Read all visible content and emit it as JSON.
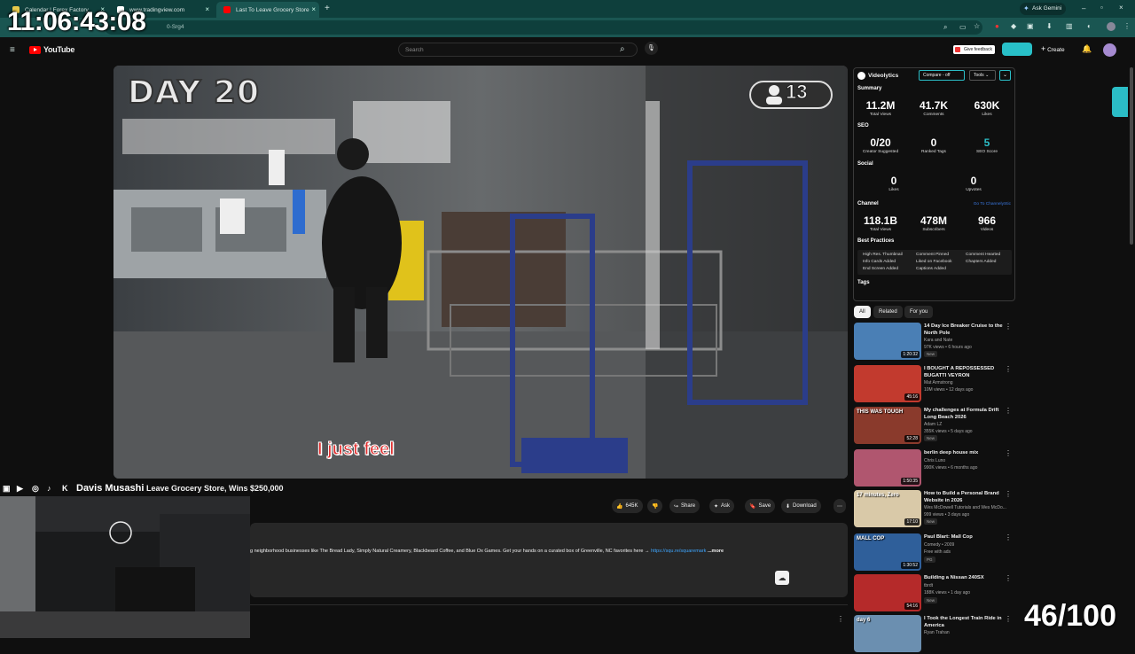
{
  "overlay": {
    "clock": "11:06:43:08",
    "counter": "46/100"
  },
  "browser": {
    "tabs": [
      {
        "title": "Calendar | Forex Factory"
      },
      {
        "title": "www.tradingview.com"
      },
      {
        "title": "Last To Leave Grocery Store"
      }
    ],
    "url": "0-Srg4",
    "gemini": "Ask Gemini"
  },
  "youtube": {
    "logo": "YouTube",
    "search_placeholder": "Search",
    "feedback": "Give feedback",
    "create": "Create"
  },
  "video": {
    "day_label": "DAY 20",
    "player_count": "13",
    "subtitle": "I just feel",
    "title": "Leave Grocery Store, Wins $250,000",
    "description": "g neighborhood businesses like The Bread Lady, Simply Natural Creamery, Blackbeard Coffee, and Blue Ox Games. Get your hands on a curated box of Greenville, NC favorites here →",
    "link": "https://squ.re/squaremark",
    "more": "...more"
  },
  "actions": {
    "likes": "645K",
    "share": "Share",
    "ask": "Ask",
    "save": "Save",
    "download": "Download"
  },
  "streamer": {
    "name": "Davis Musashi"
  },
  "videolytics": {
    "brand": "Videolytics",
    "compare": "Compare - off",
    "tools": "Tools",
    "summary_label": "Summary",
    "summary": [
      {
        "value": "11.2M",
        "label": "Total Views"
      },
      {
        "value": "41.7K",
        "label": "Comments"
      },
      {
        "value": "630K",
        "label": "Likes"
      }
    ],
    "seo_label": "SEO",
    "seo": [
      {
        "value": "0/20",
        "label": "Creator Suggested"
      },
      {
        "value": "0",
        "label": "Ranked Tags"
      },
      {
        "value": "5",
        "label": "SEO Score"
      }
    ],
    "social_label": "Social",
    "social": [
      {
        "value": "0",
        "label": "Likes"
      },
      {
        "value": "0",
        "label": "Upvotes"
      }
    ],
    "channel_label": "Channel",
    "channel_link": "Go To ChannelyStic",
    "channel": [
      {
        "value": "118.1B",
        "label": "Total Views"
      },
      {
        "value": "478M",
        "label": "Subscribers"
      },
      {
        "value": "966",
        "label": "Videos"
      }
    ],
    "best_label": "Best Practices",
    "best": [
      "High Res. Thumbnail",
      "Comment Pinned",
      "Comment Hearted",
      "Info Cards Added",
      "Liked on Facebook",
      "Chapters Added",
      "End Screen Added",
      "Captions Added"
    ],
    "tags_label": "Tags"
  },
  "chips": [
    "All",
    "Related",
    "For you"
  ],
  "recommendations": [
    {
      "title": "14 Day Ice Breaker Cruise to the North Pole",
      "channel": "Kara and Nate",
      "meta": "97K views • 6 hours ago",
      "badge": "New",
      "duration": "1:20:32",
      "color": "#4a7fb5"
    },
    {
      "title": "I BOUGHT A REPOSSESSED BUGATTI VEYRON",
      "channel": "Mat Armstrong",
      "meta": "10M views • 12 days ago",
      "badge": "",
      "duration": "45:16",
      "color": "#c23a2e"
    },
    {
      "title": "My challenges at Formula Drift Long Beach 2026",
      "channel": "Adam LZ",
      "meta": "355K views • 5 days ago",
      "badge": "New",
      "duration": "52:28",
      "color": "#8a3a2c",
      "thumb_text": "THIS WAS TOUGH"
    },
    {
      "title": "berlin deep house mix",
      "channel": "Chris Luno",
      "meta": "990K views • 6 months ago",
      "badge": "",
      "duration": "1:50:35",
      "color": "#b0566f"
    },
    {
      "title": "How to Build a Personal Brand Website in 2026",
      "channel": "Wes McDowell Tutorials and Wes McDo...",
      "meta": "999 views • 3 days ago",
      "badge": "New",
      "duration": "17:10",
      "color": "#d9c9a8",
      "thumb_text": "17 minutes, Zero"
    },
    {
      "title": "Paul Blart: Mall Cop",
      "channel": "Comedy • 2009",
      "meta": "Free with ads",
      "badge": "PG",
      "duration": "1:30:52",
      "color": "#2f5f9a",
      "thumb_text": "MALL COP"
    },
    {
      "title": "Building a Nissan 240SX",
      "channel": "tbrdt",
      "meta": "188K views • 1 day ago",
      "badge": "New",
      "duration": "54:16",
      "color": "#b52a2a"
    },
    {
      "title": "I Took the Longest Train Ride in America",
      "channel": "Ryan Trahan",
      "meta": "",
      "badge": "",
      "duration": "",
      "color": "#6b8fb0",
      "thumb_text": "day 6"
    }
  ]
}
